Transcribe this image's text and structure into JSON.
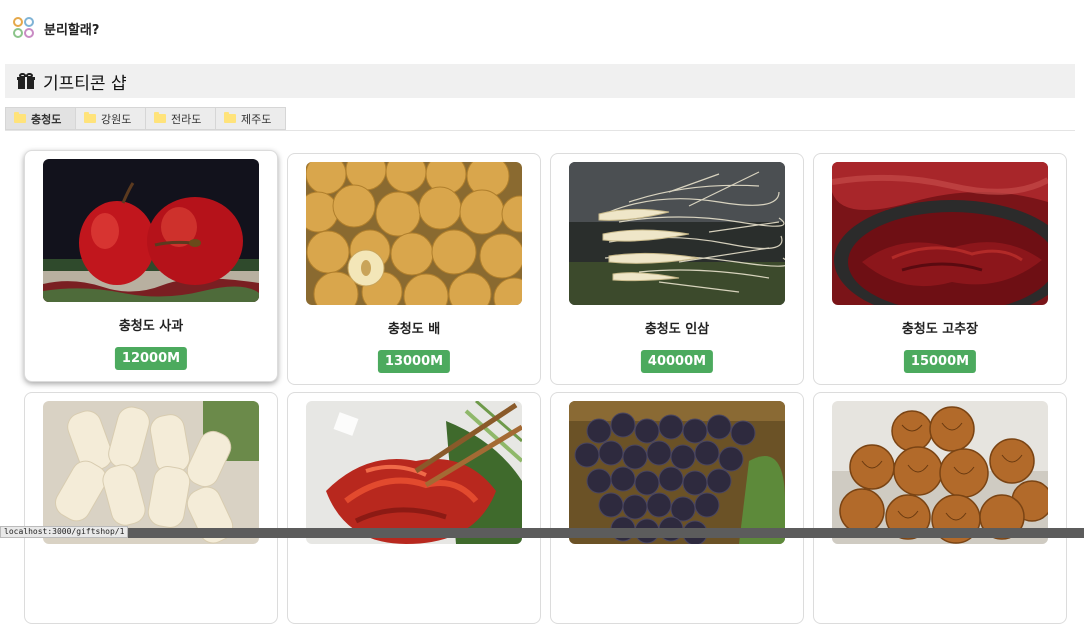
{
  "header": {
    "brand": "분리할래?"
  },
  "page": {
    "title": "기프티콘 샵"
  },
  "tabs": [
    {
      "label": "충청도",
      "active": true
    },
    {
      "label": "강원도",
      "active": false
    },
    {
      "label": "전라도",
      "active": false
    },
    {
      "label": "제주도",
      "active": false
    }
  ],
  "products": [
    {
      "name": "충청도 사과",
      "price": "12000M",
      "image": "red-apples"
    },
    {
      "name": "충청도 배",
      "price": "13000M",
      "image": "korean-pears"
    },
    {
      "name": "충청도 인삼",
      "price": "40000M",
      "image": "ginseng-roots"
    },
    {
      "name": "충청도 고추장",
      "price": "15000M",
      "image": "red-pepper-paste"
    },
    {
      "name": "",
      "price": "",
      "image": "puffed-rice-snack"
    },
    {
      "name": "",
      "price": "",
      "image": "kimchi-chopsticks"
    },
    {
      "name": "",
      "price": "",
      "image": "grapes"
    },
    {
      "name": "",
      "price": "",
      "image": "walnut-cakes"
    }
  ],
  "status": {
    "url": "localhost:3000/giftshop/1"
  },
  "colors": {
    "price_badge": "#4caa5e",
    "title_bar": "#f0f0f0",
    "folder": "#ffe37a"
  }
}
